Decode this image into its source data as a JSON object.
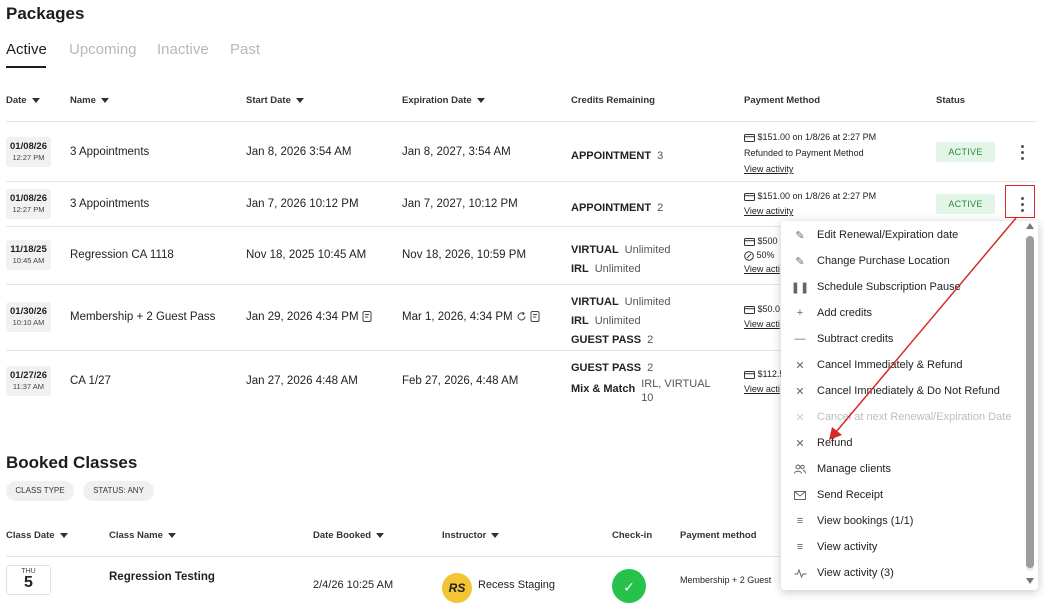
{
  "packages": {
    "title": "Packages",
    "tabs": [
      {
        "label": "Active"
      },
      {
        "label": "Upcoming"
      },
      {
        "label": "Inactive"
      },
      {
        "label": "Past"
      }
    ],
    "columns": {
      "date": "Date",
      "name": "Name",
      "start": "Start Date",
      "expiration": "Expiration Date",
      "credits": "Credits Remaining",
      "payment": "Payment Method",
      "status": "Status"
    },
    "rows": [
      {
        "date": "01/08/26",
        "time": "12:27 PM",
        "name": "3 Appointments",
        "start": "Jan 8, 2026 3:54 AM",
        "expiration": "Jan 8, 2027, 3:54 AM",
        "credits": [
          {
            "label": "APPOINTMENT",
            "value": "3"
          }
        ],
        "payment": [
          "$151.00 on 1/8/26 at 2:27 PM",
          "Refunded to Payment Method",
          "View activity"
        ],
        "status": "ACTIVE"
      },
      {
        "date": "01/08/26",
        "time": "12:27 PM",
        "name": "3 Appointments",
        "start": "Jan 7, 2026 10:12 PM",
        "expiration": "Jan 7, 2027, 10:12 PM",
        "credits": [
          {
            "label": "APPOINTMENT",
            "value": "2"
          }
        ],
        "payment": [
          "$151.00 on 1/8/26 at 2:27 PM",
          "View activity"
        ],
        "status": "ACTIVE"
      },
      {
        "date": "11/18/25",
        "time": "10:45 AM",
        "name": "Regression CA 1118",
        "start": "Nov 18, 2025 10:45 AM",
        "expiration": "Nov 18, 2026, 10:59 PM",
        "credits": [
          {
            "label": "VIRTUAL",
            "value": "Unlimited"
          },
          {
            "label": "IRL",
            "value": "Unlimited"
          }
        ],
        "payment": [
          "$500",
          "50%",
          "View acti"
        ]
      },
      {
        "date": "01/30/26",
        "time": "10:10 AM",
        "name": "Membership + 2 Guest Pass",
        "start": "Jan 29, 2026 4:34 PM",
        "expiration": "Mar 1, 2026, 4:34 PM",
        "credits": [
          {
            "label": "VIRTUAL",
            "value": "Unlimited"
          },
          {
            "label": "IRL",
            "value": "Unlimited"
          },
          {
            "label": "GUEST PASS",
            "value": "2"
          }
        ],
        "payment": [
          "$50.0",
          "View acti"
        ]
      },
      {
        "date": "01/27/26",
        "time": "11:37 AM",
        "name": "CA 1/27",
        "start": "Jan 27, 2026 4:48 AM",
        "expiration": "Feb 27, 2026, 4:48 AM",
        "credits": [
          {
            "label": "GUEST PASS",
            "value": "2"
          },
          {
            "label": "Mix & Match",
            "value": "IRL, VIRTUAL 10"
          }
        ],
        "payment": [
          "$112.5",
          "View acti"
        ]
      }
    ]
  },
  "booked": {
    "title": "Booked Classes",
    "filters": [
      "CLASS TYPE",
      "STATUS: ANY"
    ],
    "columns": {
      "class_date": "Class Date",
      "class_name": "Class Name",
      "date_booked": "Date Booked",
      "instructor": "Instructor",
      "checkin": "Check-in",
      "payment": "Payment method"
    },
    "row": {
      "dow": "THU",
      "day": "5",
      "class_name": "Regression Testing",
      "date_booked": "2/4/26 10:25 AM",
      "instructor_initials": "RS",
      "instructor": "Recess Staging",
      "payment": "Membership + 2 Guest"
    }
  },
  "context_menu": {
    "items": [
      {
        "label": "Edit Renewal/Expiration date",
        "icon": "pencil-icon",
        "disabled": false
      },
      {
        "label": "Change Purchase Location",
        "icon": "pencil-icon",
        "disabled": false
      },
      {
        "label": "Schedule Subscription Pause",
        "icon": "pause-icon",
        "disabled": false
      },
      {
        "label": "Add credits",
        "icon": "plus-icon",
        "disabled": false
      },
      {
        "label": "Subtract credits",
        "icon": "minus-icon",
        "disabled": false
      },
      {
        "label": "Cancel Immediately & Refund",
        "icon": "close-icon",
        "disabled": false
      },
      {
        "label": "Cancel Immediately & Do Not Refund",
        "icon": "close-icon",
        "disabled": false
      },
      {
        "label": "Cancel at next Renewal/Expiration Date",
        "icon": "close-icon",
        "disabled": true
      },
      {
        "label": "Refund",
        "icon": "close-icon",
        "disabled": false
      },
      {
        "label": "Manage clients",
        "icon": "users-icon",
        "disabled": false
      },
      {
        "label": "Send Receipt",
        "icon": "envelope-icon",
        "disabled": false
      },
      {
        "label": "View bookings (1/1)",
        "icon": "list-icon",
        "disabled": false
      },
      {
        "label": "View activity",
        "icon": "list-icon",
        "disabled": false
      },
      {
        "label": "View activity (3)",
        "icon": "activity-icon",
        "disabled": false
      }
    ]
  },
  "colors": {
    "active_badge_bg": "#e3f5e6",
    "active_badge_text": "#2a8a3a",
    "highlight": "#d62a2a",
    "checkin": "#27c24c",
    "avatar": "#f3c433"
  }
}
